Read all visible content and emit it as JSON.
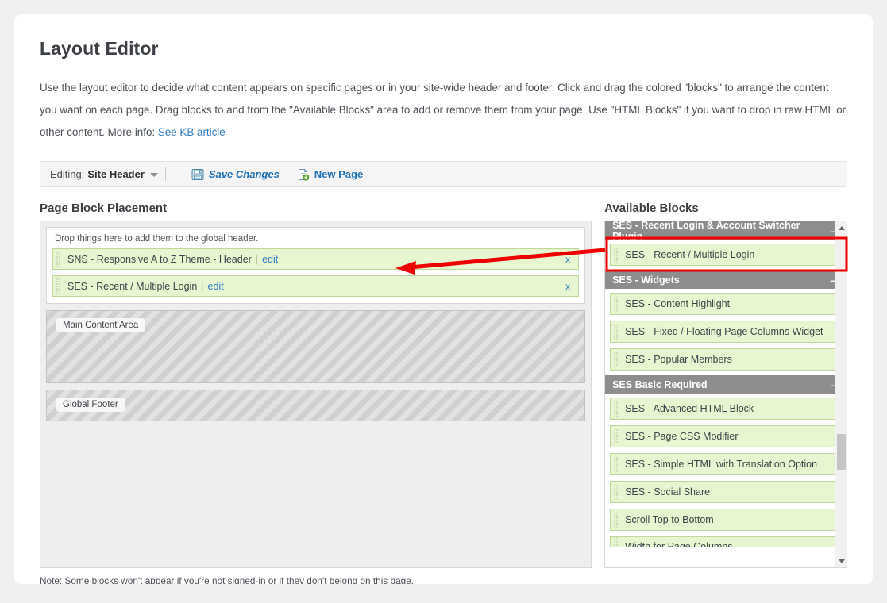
{
  "page": {
    "title": "Layout Editor",
    "intro": "Use the layout editor to decide what content appears on specific pages or in your site-wide header and footer. Click and drag the colored \"blocks\" to arrange the content you want on each page. Drag blocks to and from the \"Available Blocks\" area to add or remove them from your page. Use \"HTML Blocks\" if you want to drop in raw HTML or other content. More info: ",
    "kb_link": "See KB article",
    "note": "Note: Some blocks won't appear if you're not signed-in or if they don't belong on this page."
  },
  "toolbar": {
    "editing_label": "Editing:",
    "editing_value": "Site Header",
    "save_label": "Save Changes",
    "new_page_label": "New Page"
  },
  "left_panel": {
    "heading": "Page Block Placement",
    "dropzone_hint": "Drop things here to add them to the global header.",
    "blocks": [
      {
        "label": "SNS - Responsive A to Z Theme - Header",
        "edit": "edit",
        "remove": "x"
      },
      {
        "label": "SES - Recent / Multiple Login",
        "edit": "edit",
        "remove": "x"
      }
    ],
    "placeholders": [
      {
        "label": "Main Content Area"
      },
      {
        "label": "Global Footer"
      }
    ]
  },
  "right_panel": {
    "heading": "Available Blocks",
    "categories": [
      {
        "name": "SES - Recent Login & Account Switcher Plugin",
        "collapse": "–",
        "items": [
          "SES - Recent / Multiple Login"
        ]
      },
      {
        "name": "SES - Widgets",
        "collapse": "–",
        "items": [
          "SES - Content Highlight",
          "SES - Fixed / Floating Page Columns Widget",
          "SES - Popular Members"
        ]
      },
      {
        "name": "SES Basic Required",
        "collapse": "–",
        "items": [
          "SES - Advanced HTML Block",
          "SES - Page CSS Modifier",
          "SES - Simple HTML with Translation Option",
          "SES - Social Share",
          "Scroll Top to Bottom",
          "Width for Page Columns"
        ]
      }
    ]
  },
  "colors": {
    "block_bg": "#e7f5d0",
    "block_border": "#bfd89a",
    "category_bg": "#8d8d8d",
    "link": "#2e7cc4",
    "annotation": "#ee0000"
  }
}
